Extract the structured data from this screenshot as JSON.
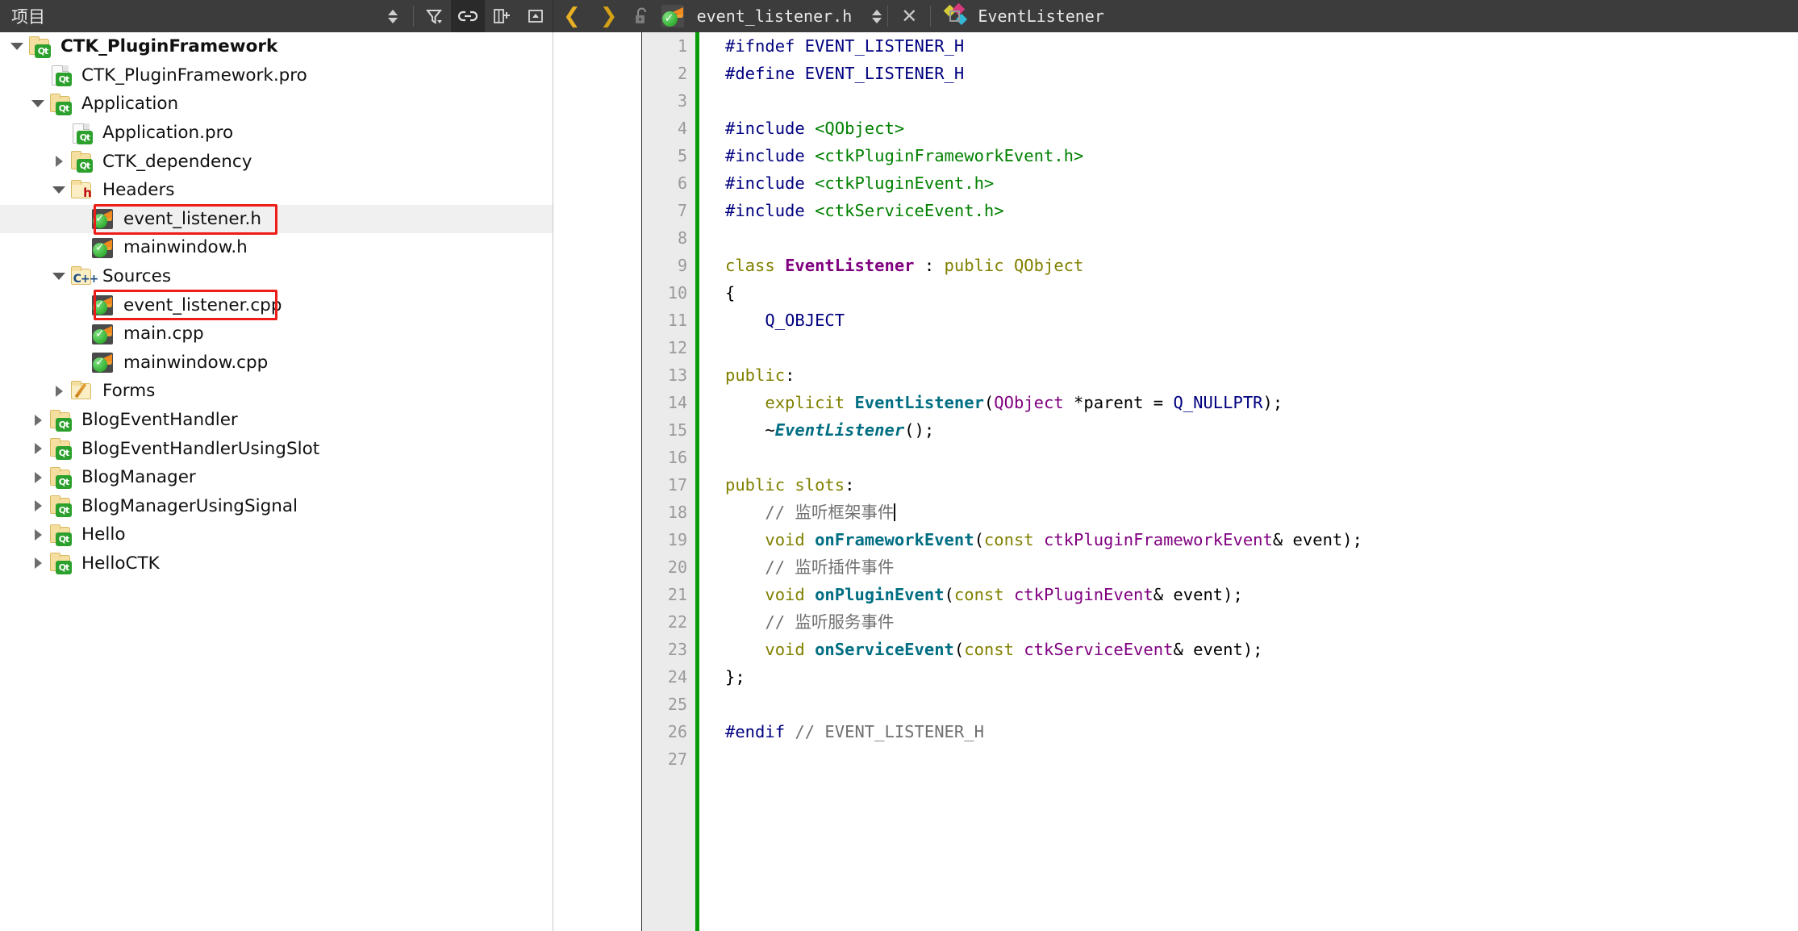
{
  "topbar": {
    "panel_title": "项目",
    "sort_icon": "sort-updown-icon",
    "filter_icon": "filter-icon",
    "link_icon": "link-with-editor-icon",
    "split_icon": "add-split-icon",
    "close_panel_icon": "close-panel-icon",
    "back_icon": "go-back-icon",
    "forward_icon": "go-forward-icon",
    "lock_icon": "unlocked-icon",
    "file_icon": "qt-header-file-icon",
    "filename": "event_listener.h",
    "file_dropdown_icon": "chevron-updown-icon",
    "close_icon": "close-document-icon",
    "symbol_icon": "class-symbol-icon",
    "symbol_name": "EventListener"
  },
  "tree": {
    "items": [
      {
        "label": "CTK_PluginFramework",
        "indent": 0,
        "arrow": "down",
        "icon": "folder-qt",
        "bold": true,
        "selected": false
      },
      {
        "label": "CTK_PluginFramework.pro",
        "indent": 1,
        "arrow": "none",
        "icon": "doc-qt",
        "bold": false,
        "selected": false
      },
      {
        "label": "Application",
        "indent": 1,
        "arrow": "down",
        "icon": "folder-qt",
        "bold": false,
        "selected": false
      },
      {
        "label": "Application.pro",
        "indent": 2,
        "arrow": "none",
        "icon": "doc-qt",
        "bold": false,
        "selected": false
      },
      {
        "label": "CTK_dependency",
        "indent": 2,
        "arrow": "right",
        "icon": "folder-qt",
        "bold": false,
        "selected": false
      },
      {
        "label": "Headers",
        "indent": 2,
        "arrow": "down",
        "icon": "folder-h",
        "bold": false,
        "selected": false
      },
      {
        "label": "event_listener.h",
        "indent": 3,
        "arrow": "none",
        "icon": "qt-file",
        "bold": false,
        "selected": true
      },
      {
        "label": "mainwindow.h",
        "indent": 3,
        "arrow": "none",
        "icon": "qt-file",
        "bold": false,
        "selected": false
      },
      {
        "label": "Sources",
        "indent": 2,
        "arrow": "down",
        "icon": "folder-cpp",
        "bold": false,
        "selected": false
      },
      {
        "label": "event_listener.cpp",
        "indent": 3,
        "arrow": "none",
        "icon": "qt-file",
        "bold": false,
        "selected": false
      },
      {
        "label": "main.cpp",
        "indent": 3,
        "arrow": "none",
        "icon": "qt-file",
        "bold": false,
        "selected": false
      },
      {
        "label": "mainwindow.cpp",
        "indent": 3,
        "arrow": "none",
        "icon": "qt-file",
        "bold": false,
        "selected": false
      },
      {
        "label": "Forms",
        "indent": 2,
        "arrow": "right",
        "icon": "folder-form",
        "bold": false,
        "selected": false
      },
      {
        "label": "BlogEventHandler",
        "indent": 1,
        "arrow": "right",
        "icon": "folder-qt",
        "bold": false,
        "selected": false
      },
      {
        "label": "BlogEventHandlerUsingSlot",
        "indent": 1,
        "arrow": "right",
        "icon": "folder-qt",
        "bold": false,
        "selected": false
      },
      {
        "label": "BlogManager",
        "indent": 1,
        "arrow": "right",
        "icon": "folder-qt",
        "bold": false,
        "selected": false
      },
      {
        "label": "BlogManagerUsingSignal",
        "indent": 1,
        "arrow": "right",
        "icon": "folder-qt",
        "bold": false,
        "selected": false
      },
      {
        "label": "Hello",
        "indent": 1,
        "arrow": "right",
        "icon": "folder-qt",
        "bold": false,
        "selected": false
      },
      {
        "label": "HelloCTK",
        "indent": 1,
        "arrow": "right",
        "icon": "folder-qt",
        "bold": false,
        "selected": false
      }
    ],
    "highlight_color": "#ee1c16",
    "highlighted_rows": [
      6,
      9
    ]
  },
  "editor": {
    "line_numbers": [
      "1",
      "2",
      "3",
      "4",
      "5",
      "6",
      "7",
      "8",
      "9",
      "10",
      "11",
      "12",
      "13",
      "14",
      "15",
      "16",
      "17",
      "18",
      "19",
      "20",
      "21",
      "22",
      "23",
      "24",
      "25",
      "26",
      "27"
    ],
    "fold_marker_line": 9,
    "change_bar_color": "#0a9b0a",
    "cursor_line": 18,
    "lines": [
      {
        "n": 1,
        "tokens": [
          {
            "t": "#ifndef ",
            "c": "pp"
          },
          {
            "t": "EVENT_LISTENER_H",
            "c": "pp"
          }
        ]
      },
      {
        "n": 2,
        "tokens": [
          {
            "t": "#define ",
            "c": "pp"
          },
          {
            "t": "EVENT_LISTENER_H",
            "c": "pp"
          }
        ]
      },
      {
        "n": 3,
        "tokens": []
      },
      {
        "n": 4,
        "tokens": [
          {
            "t": "#include ",
            "c": "pp"
          },
          {
            "t": "<QObject>",
            "c": "inc"
          }
        ]
      },
      {
        "n": 5,
        "tokens": [
          {
            "t": "#include ",
            "c": "pp"
          },
          {
            "t": "<ctkPluginFrameworkEvent.h>",
            "c": "inc"
          }
        ]
      },
      {
        "n": 6,
        "tokens": [
          {
            "t": "#include ",
            "c": "pp"
          },
          {
            "t": "<ctkPluginEvent.h>",
            "c": "inc"
          }
        ]
      },
      {
        "n": 7,
        "tokens": [
          {
            "t": "#include ",
            "c": "pp"
          },
          {
            "t": "<ctkServiceEvent.h>",
            "c": "inc"
          }
        ]
      },
      {
        "n": 8,
        "tokens": []
      },
      {
        "n": 9,
        "tokens": [
          {
            "t": "class ",
            "c": "kw"
          },
          {
            "t": "EventListener",
            "c": "typ"
          },
          {
            "t": " : ",
            "c": "pl"
          },
          {
            "t": "public ",
            "c": "kw"
          },
          {
            "t": "QObject",
            "c": "kw"
          }
        ]
      },
      {
        "n": 10,
        "tokens": [
          {
            "t": "{",
            "c": "pl"
          }
        ]
      },
      {
        "n": 11,
        "tokens": [
          {
            "t": "    ",
            "c": "pl"
          },
          {
            "t": "Q_OBJECT",
            "c": "mac"
          }
        ]
      },
      {
        "n": 12,
        "tokens": []
      },
      {
        "n": 13,
        "tokens": [
          {
            "t": "public",
            "c": "kw"
          },
          {
            "t": ":",
            "c": "pl"
          }
        ]
      },
      {
        "n": 14,
        "tokens": [
          {
            "t": "    ",
            "c": "pl"
          },
          {
            "t": "explicit ",
            "c": "kw"
          },
          {
            "t": "EventListener",
            "c": "fn"
          },
          {
            "t": "(",
            "c": "pl"
          },
          {
            "t": "QObject",
            "c": "typm"
          },
          {
            "t": " *parent = ",
            "c": "pl"
          },
          {
            "t": "Q_NULLPTR",
            "c": "mac"
          },
          {
            "t": ");",
            "c": "pl"
          }
        ]
      },
      {
        "n": 15,
        "tokens": [
          {
            "t": "    ~",
            "c": "pl"
          },
          {
            "t": "EventListener",
            "c": "fni"
          },
          {
            "t": "();",
            "c": "pl"
          }
        ]
      },
      {
        "n": 16,
        "tokens": []
      },
      {
        "n": 17,
        "tokens": [
          {
            "t": "public slots",
            "c": "kw"
          },
          {
            "t": ":",
            "c": "pl"
          }
        ]
      },
      {
        "n": 18,
        "tokens": [
          {
            "t": "    ",
            "c": "pl"
          },
          {
            "t": "// 监听框架事件",
            "c": "cm"
          }
        ],
        "cursor": true
      },
      {
        "n": 19,
        "tokens": [
          {
            "t": "    ",
            "c": "pl"
          },
          {
            "t": "void ",
            "c": "kw"
          },
          {
            "t": "onFrameworkEvent",
            "c": "fn"
          },
          {
            "t": "(",
            "c": "pl"
          },
          {
            "t": "const ",
            "c": "kw"
          },
          {
            "t": "ctkPluginFrameworkEvent",
            "c": "typm"
          },
          {
            "t": "& event);",
            "c": "pl"
          }
        ]
      },
      {
        "n": 20,
        "tokens": [
          {
            "t": "    ",
            "c": "pl"
          },
          {
            "t": "// 监听插件事件",
            "c": "cm"
          }
        ]
      },
      {
        "n": 21,
        "tokens": [
          {
            "t": "    ",
            "c": "pl"
          },
          {
            "t": "void ",
            "c": "kw"
          },
          {
            "t": "onPluginEvent",
            "c": "fn"
          },
          {
            "t": "(",
            "c": "pl"
          },
          {
            "t": "const ",
            "c": "kw"
          },
          {
            "t": "ctkPluginEvent",
            "c": "typm"
          },
          {
            "t": "& event);",
            "c": "pl"
          }
        ]
      },
      {
        "n": 22,
        "tokens": [
          {
            "t": "    ",
            "c": "pl"
          },
          {
            "t": "// 监听服务事件",
            "c": "cm"
          }
        ]
      },
      {
        "n": 23,
        "tokens": [
          {
            "t": "    ",
            "c": "pl"
          },
          {
            "t": "void ",
            "c": "kw"
          },
          {
            "t": "onServiceEvent",
            "c": "fn"
          },
          {
            "t": "(",
            "c": "pl"
          },
          {
            "t": "const ",
            "c": "kw"
          },
          {
            "t": "ctkServiceEvent",
            "c": "typm"
          },
          {
            "t": "& event);",
            "c": "pl"
          }
        ]
      },
      {
        "n": 24,
        "tokens": [
          {
            "t": "};",
            "c": "pl"
          }
        ]
      },
      {
        "n": 25,
        "tokens": []
      },
      {
        "n": 26,
        "tokens": [
          {
            "t": "#endif ",
            "c": "pp"
          },
          {
            "t": "// EVENT_LISTENER_H",
            "c": "cm"
          }
        ]
      },
      {
        "n": 27,
        "tokens": []
      }
    ]
  }
}
